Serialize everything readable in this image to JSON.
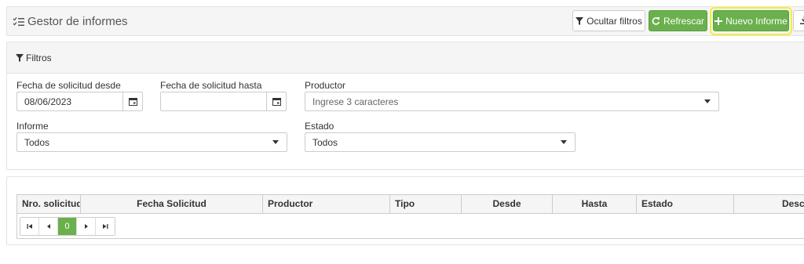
{
  "header": {
    "title": "Gestor de informes",
    "btn_hide_filters": "Ocultar filtros",
    "btn_refresh": "Refrescar",
    "btn_new_report": "Nuevo Informe"
  },
  "filters": {
    "panel_title": "Filtros",
    "date_from_label": "Fecha de solicitud desde",
    "date_from_value": "08/06/2023",
    "date_to_label": "Fecha de solicitud hasta",
    "date_to_value": "",
    "producer_label": "Productor",
    "producer_placeholder": "Ingrese 3 caracteres",
    "report_label": "Informe",
    "report_value": "Todos",
    "status_label": "Estado",
    "status_value": "Todos"
  },
  "grid": {
    "columns": [
      "Nro. solicitud",
      "Fecha Solicitud",
      "Productor",
      "Tipo",
      "Desde",
      "Hasta",
      "Estado",
      "Descar"
    ],
    "current_page": "0"
  },
  "colors": {
    "success": "#6ab04c",
    "highlight": "#f2ef3a"
  }
}
